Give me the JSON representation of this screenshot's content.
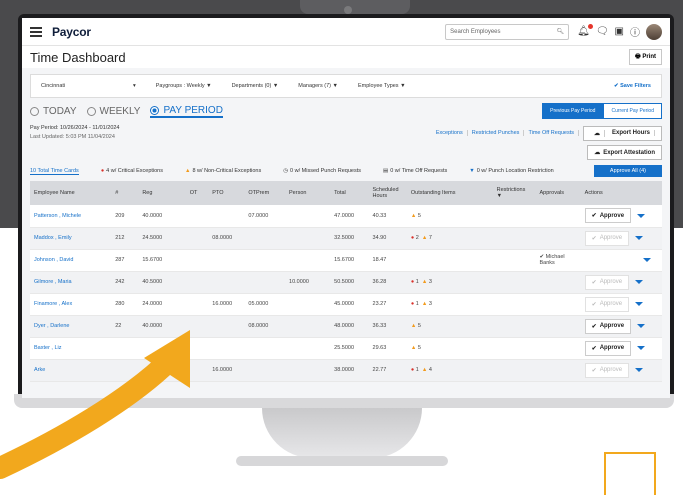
{
  "app": {
    "logo": "Paycor",
    "search_placeholder": "Search Employees",
    "page_title": "Time Dashboard",
    "print_label": "Print"
  },
  "filters": {
    "location": "Cincinnati",
    "paygroups": "Paygroups : Weekly",
    "departments": "Departments (0)",
    "managers": "Managers (7)",
    "employee_types": "Employee Types",
    "save_label": "Save Filters"
  },
  "period": {
    "today": "TODAY",
    "weekly": "WEEKLY",
    "pay_period": "PAY PERIOD",
    "previous_btn": "Previous Pay Period",
    "current_btn": "Current Pay Period",
    "range": "Pay Period: 10/26/2024 - 11/01/2024",
    "last_updated": "Last Updated: 5:03 PM 11/04/2024"
  },
  "links": {
    "exceptions": "Exceptions",
    "restricted": "Restricted Punches",
    "time_off": "Time Off Requests",
    "export_hours": "Export Hours",
    "export_attestation": "Export Attestation"
  },
  "summary": {
    "total": "10 Total Time Cards",
    "critical": "4 w/ Critical Exceptions",
    "noncritical": "8 w/ Non-Critical Exceptions",
    "missed": "0 w/ Missed Punch Requests",
    "timeoff": "0 w/ Time Off Requests",
    "location": "0 w/ Punch Location Restriction",
    "approve_all": "Approve All (4)"
  },
  "table": {
    "headers": {
      "name": "Employee Name",
      "num": "#",
      "reg": "Reg",
      "ot": "OT",
      "pto": "PTO",
      "otprem": "OTPrem",
      "person": "Person",
      "total": "Total",
      "scheduled": "Scheduled Hours",
      "outstanding": "Outstanding Items",
      "restrictions": "Restrictions",
      "approvals": "Approvals",
      "actions": "Actions"
    },
    "approve_label": "Approve",
    "rows": [
      {
        "name": "Patterson , Michele",
        "num": "209",
        "reg": "40.0000",
        "pto": "",
        "otprem": "07.0000",
        "person": "",
        "total": "47.0000",
        "sched": "40.33",
        "crit": "",
        "warn": "5",
        "approval": "",
        "active": true
      },
      {
        "name": "Maddox , Emily",
        "num": "212",
        "reg": "24.5000",
        "pto": "08.0000",
        "otprem": "",
        "person": "",
        "total": "32.5000",
        "sched": "34.90",
        "crit": "2",
        "warn": "7",
        "approval": "",
        "active": false
      },
      {
        "name": "Johnson , David",
        "num": "287",
        "reg": "15.6700",
        "pto": "",
        "otprem": "",
        "person": "",
        "total": "15.6700",
        "sched": "18.47",
        "crit": "",
        "warn": "",
        "approval": "Michael Banks",
        "active": null
      },
      {
        "name": "Gilmore , Maria",
        "num": "242",
        "reg": "40.5000",
        "pto": "",
        "otprem": "",
        "person": "10.0000",
        "total": "50.5000",
        "sched": "36.28",
        "crit": "1",
        "warn": "3",
        "approval": "",
        "active": false
      },
      {
        "name": "Finamore , Alex",
        "num": "280",
        "reg": "24.0000",
        "pto": "16.0000",
        "otprem": "05.0000",
        "person": "",
        "total": "45.0000",
        "sched": "23.27",
        "crit": "1",
        "warn": "3",
        "approval": "",
        "active": false
      },
      {
        "name": "Dyer , Darlene",
        "num": "22",
        "reg": "40.0000",
        "pto": "",
        "otprem": "08.0000",
        "person": "",
        "total": "48.0000",
        "sched": "36.33",
        "crit": "",
        "warn": "5",
        "approval": "",
        "active": true
      },
      {
        "name": "Baxter , Liz",
        "num": "",
        "reg": "",
        "pto": "",
        "otprem": "",
        "person": "",
        "total": "25.5000",
        "sched": "29.63",
        "crit": "",
        "warn": "5",
        "approval": "",
        "active": true
      },
      {
        "name": "Arke",
        "num": "",
        "reg": "",
        "pto": "16.0000",
        "otprem": "",
        "person": "",
        "total": "38.0000",
        "sched": "22.77",
        "crit": "1",
        "warn": "4",
        "approval": "",
        "active": false
      }
    ]
  },
  "colors": {
    "primary": "#1570c9",
    "critical": "#d9302a",
    "warning": "#f29b1d",
    "arrow": "#f2a81d"
  }
}
